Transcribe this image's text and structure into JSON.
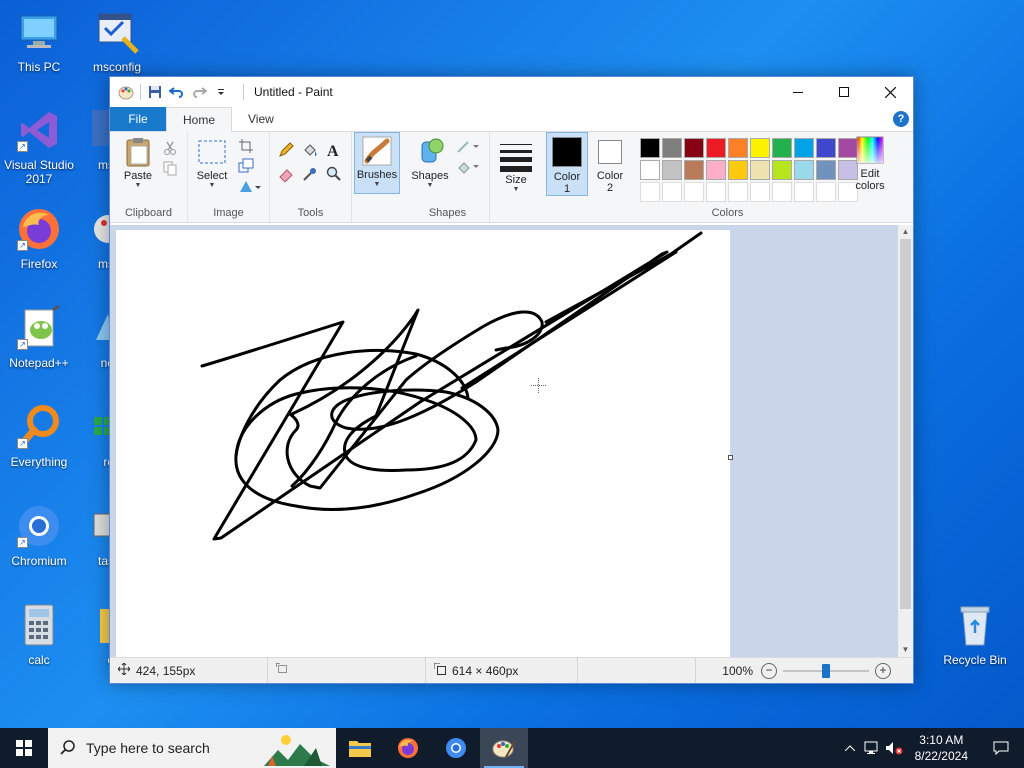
{
  "desktop": {
    "icons_left": [
      {
        "label": "This PC",
        "icon": "computer-icon"
      },
      {
        "label": "Visual Studio 2017",
        "icon": "visual-studio-icon"
      },
      {
        "label": "Firefox",
        "icon": "firefox-icon"
      },
      {
        "label": "Notepad++",
        "icon": "notepadpp-icon"
      },
      {
        "label": "Everything",
        "icon": "everything-icon"
      },
      {
        "label": "Chromium",
        "icon": "chromium-icon"
      },
      {
        "label": "calc",
        "icon": "calculator-icon"
      }
    ],
    "icons_second": [
      {
        "label": "msconfig",
        "icon": "msconfig-icon"
      },
      {
        "label": "ms",
        "icon": "app-icon"
      },
      {
        "label": "ms",
        "icon": "app-icon"
      },
      {
        "label": "no",
        "icon": "app-icon"
      },
      {
        "label": "re",
        "icon": "app-icon"
      },
      {
        "label": "tas",
        "icon": "app-icon"
      },
      {
        "label": "e",
        "icon": "folder-icon"
      }
    ],
    "recycle_bin": "Recycle Bin"
  },
  "paint": {
    "title": "Untitled - Paint",
    "tabs": {
      "file": "File",
      "home": "Home",
      "view": "View"
    },
    "groups": {
      "clipboard": {
        "label": "Clipboard",
        "paste": "Paste"
      },
      "image": {
        "label": "Image",
        "select": "Select"
      },
      "tools": {
        "label": "Tools"
      },
      "brushes": {
        "label": "Brushes"
      },
      "shapes": {
        "label": "Shapes",
        "shapes_btn": "Shapes"
      },
      "size": {
        "label": "Size"
      },
      "colors": {
        "label": "Colors",
        "color1_line1": "Color",
        "color1_line2": "1",
        "color2_line1": "Color",
        "color2_line2": "2",
        "edit_line1": "Edit",
        "edit_line2": "colors",
        "color1": "#000000",
        "color2": "#ffffff",
        "palette_row1": [
          "#000000",
          "#7f7f7f",
          "#880015",
          "#ed1c24",
          "#ff7f27",
          "#fff200",
          "#22b14c",
          "#00a2e8",
          "#3f48cc",
          "#a349a4"
        ],
        "palette_row2": [
          "#ffffff",
          "#c3c3c3",
          "#b97a57",
          "#ffaec9",
          "#ffc90e",
          "#efe4b0",
          "#b5e61d",
          "#99d9ea",
          "#7092be",
          "#c8bfe7"
        ]
      }
    },
    "status": {
      "cursor_pos": "424, 155px",
      "image_size": "614 × 460px",
      "zoom": "100%",
      "zoom_level_percent": 100
    }
  },
  "taskbar": {
    "search_placeholder": "Type here to search",
    "time": "3:10 AM",
    "date": "8/22/2024"
  }
}
